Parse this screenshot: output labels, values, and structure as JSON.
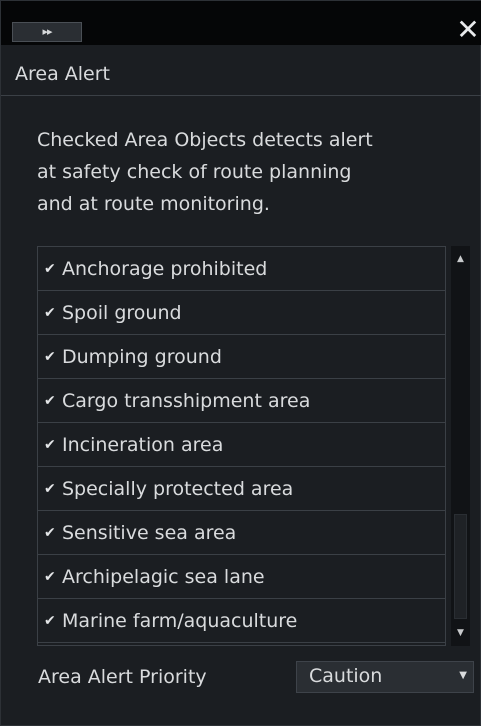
{
  "titlebar": {
    "collapse_label": "▸▸",
    "close_label": "✕"
  },
  "header": {
    "title": "Area Alert"
  },
  "description": "Checked Area Objects detects alert\nat safety check of route planning\nand at route monitoring.",
  "area_objects": [
    {
      "label": "Anchorage prohibited",
      "checked": true
    },
    {
      "label": "Spoil ground",
      "checked": true
    },
    {
      "label": "Dumping ground",
      "checked": true
    },
    {
      "label": "Cargo transshipment area",
      "checked": true
    },
    {
      "label": "Incineration area",
      "checked": true
    },
    {
      "label": "Specially protected area",
      "checked": true
    },
    {
      "label": "Sensitive sea area",
      "checked": true
    },
    {
      "label": "Archipelagic sea lane",
      "checked": true
    },
    {
      "label": "Marine farm/aquaculture",
      "checked": true
    }
  ],
  "scrollbar": {
    "up_icon": "scroll-up-icon",
    "down_icon": "scroll-down-icon"
  },
  "priority": {
    "label": "Area Alert Priority",
    "selected": "Caution"
  },
  "colors": {
    "panel_bg": "#1b1e22",
    "titlebar_bg": "#050607",
    "border": "#3b4046",
    "text": "#d9dbdd"
  }
}
